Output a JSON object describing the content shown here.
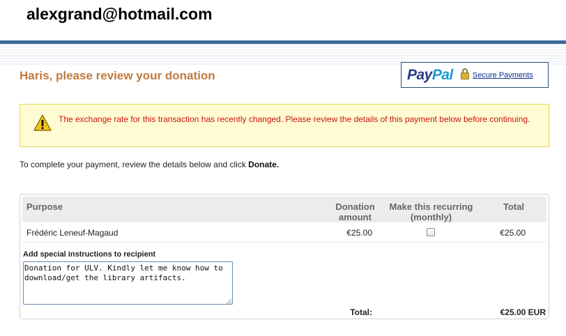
{
  "header": {
    "email": "alexgrand@hotmail.com"
  },
  "page": {
    "title": "Haris, please review your donation"
  },
  "brand": {
    "logo_part1": "Pay",
    "logo_part2": "Pal",
    "secure_link": "Secure Payments",
    "colors": {
      "dark_blue": "#253b80",
      "light_blue": "#179bd7",
      "rule": "#3a6a9a",
      "title": "#c07a3f"
    }
  },
  "alert": {
    "message": "The exchange rate for this transaction has recently changed. Please review the details of this payment below before continuing.",
    "icon": "warning-icon",
    "text_color": "#cc1111"
  },
  "instructions": {
    "prefix": "To complete your payment, review the details below and click ",
    "action": "Donate."
  },
  "table": {
    "headers": {
      "purpose": "Purpose",
      "amount_line1": "Donation",
      "amount_line2": "amount",
      "recurring_line1": "Make this recurring",
      "recurring_line2": "(monthly)",
      "total": "Total"
    },
    "rows": [
      {
        "purpose": "Frédéric Leneuf-Magaud",
        "amount": "€25.00",
        "recurring": false,
        "total": "€25.00"
      }
    ],
    "note_label": "Add special instructions to recipient",
    "note_value": "Donation for ULV. Kindly let me know how to download/get the library artifacts.",
    "total_label": "Total:",
    "total_value": "€25.00  EUR"
  }
}
